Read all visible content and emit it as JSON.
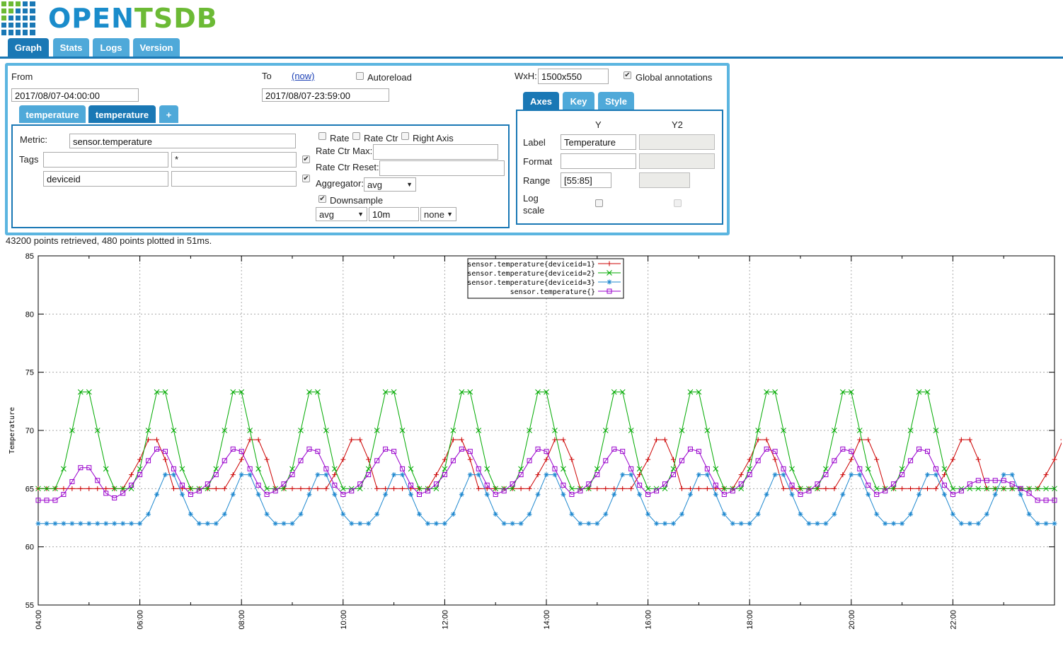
{
  "app": {
    "logo_open": "OPEN",
    "logo_tsdb": "TSDB"
  },
  "tabs": [
    {
      "label": "Graph",
      "active": true
    },
    {
      "label": "Stats"
    },
    {
      "label": "Logs"
    },
    {
      "label": "Version"
    }
  ],
  "query": {
    "from_label": "From",
    "from_value": "2017/08/07-04:00:00",
    "to_label": "To",
    "to_now_link": "(now)",
    "to_value": "2017/08/07-23:59:00",
    "autoreload_label": "Autoreload",
    "wxh_label": "WxH:",
    "wxh_value": "1500x550",
    "global_annotations_label": "Global annotations",
    "metric_tabs": [
      "temperature",
      "temperature",
      "+"
    ],
    "metric_label": "Metric:",
    "metric_value": "sensor.temperature",
    "tags_label": "Tags",
    "tags": [
      {
        "key": "",
        "value": "*"
      },
      {
        "key": "deviceid",
        "value": ""
      }
    ],
    "rate_label": "Rate",
    "rate_ctr_label": "Rate Ctr",
    "right_axis_label": "Right Axis",
    "rate_ctr_max_label": "Rate Ctr Max:",
    "rate_ctr_reset_label": "Rate Ctr Reset:",
    "aggregator_label": "Aggregator:",
    "aggregator_value": "avg",
    "downsample_label": "Downsample",
    "downsample_func": "avg",
    "downsample_interval": "10m",
    "downsample_fill": "none"
  },
  "axes": {
    "tabs": [
      "Axes",
      "Key",
      "Style"
    ],
    "col_y": "Y",
    "col_y2": "Y2",
    "label_label": "Label",
    "label_y": "Temperature",
    "format_label": "Format",
    "range_label": "Range",
    "range_y": "[55:85]",
    "log_label_1": "Log",
    "log_label_2": "scale"
  },
  "status": "43200 points retrieved, 480 points plotted in 51ms.",
  "colors": {
    "accent": "#1a78b5",
    "tab_light": "#4fa9d9",
    "panel_border": "#5bb5e0"
  },
  "chart_data": {
    "type": "line",
    "ylabel": "Temperature",
    "ylim": [
      55,
      85
    ],
    "yticks": [
      55,
      60,
      65,
      70,
      75,
      80,
      85
    ],
    "xlim": [
      "04:00",
      "24:00"
    ],
    "xticks": [
      "04:00",
      "06:00",
      "08:00",
      "10:00",
      "12:00",
      "14:00",
      "16:00",
      "18:00",
      "20:00",
      "22:00"
    ],
    "grid": true,
    "legend_position": "top-center",
    "series": [
      {
        "name": "sensor.temperature{deviceid=1}",
        "color": "#cc0000",
        "marker": "plus",
        "x_start_hours": 4.0,
        "x_step_minutes": 10,
        "values": [
          65,
          65,
          65,
          65,
          65,
          65,
          65,
          65,
          65,
          65,
          65,
          66.2,
          67.5,
          69.2,
          69.2,
          67.5,
          65,
          65,
          65,
          65,
          65,
          65,
          65,
          66.2,
          67.5,
          69.2,
          69.2,
          67.5,
          65,
          65,
          65,
          65,
          65,
          65,
          65,
          66.2,
          67.5,
          69.2,
          69.2,
          67.5,
          65,
          65,
          65,
          65,
          65,
          65,
          65,
          66.2,
          67.5,
          69.2,
          69.2,
          67.5,
          65,
          65,
          65,
          65,
          65,
          65,
          65,
          66.2,
          67.5,
          69.2,
          69.2,
          67.5,
          65,
          65,
          65,
          65,
          65,
          65,
          65,
          66.2,
          67.5,
          69.2,
          69.2,
          67.5,
          65,
          65,
          65,
          65,
          65,
          65,
          65,
          66.2,
          67.5,
          69.2,
          69.2,
          67.5,
          65,
          65,
          65,
          65,
          65,
          65,
          65,
          66.2,
          67.5,
          69.2,
          69.2,
          67.5,
          65,
          65,
          65,
          65,
          65,
          65,
          65,
          66.2,
          67.5,
          69.2,
          69.2,
          67.5,
          65,
          65,
          65,
          65,
          65,
          65,
          65,
          66.2,
          67.5,
          69.2,
          69.2,
          67.5,
          65,
          65
        ]
      },
      {
        "name": "sensor.temperature{deviceid=2}",
        "color": "#00aa00",
        "marker": "cross",
        "x_start_hours": 4.0,
        "x_step_minutes": 10,
        "values": [
          65,
          65,
          65,
          66.7,
          70,
          73.3,
          73.3,
          70,
          66.7,
          65,
          65,
          65,
          66.7,
          70,
          73.3,
          73.3,
          70,
          66.7,
          65,
          65,
          65,
          66.7,
          70,
          73.3,
          73.3,
          70,
          66.7,
          65,
          65,
          65,
          66.7,
          70,
          73.3,
          73.3,
          70,
          66.7,
          65,
          65,
          65,
          66.7,
          70,
          73.3,
          73.3,
          70,
          66.7,
          65,
          65,
          65,
          66.7,
          70,
          73.3,
          73.3,
          70,
          66.7,
          65,
          65,
          65,
          66.7,
          70,
          73.3,
          73.3,
          70,
          66.7,
          65,
          65,
          65,
          66.7,
          70,
          73.3,
          73.3,
          70,
          66.7,
          65,
          65,
          65,
          66.7,
          70,
          73.3,
          73.3,
          70,
          66.7,
          65,
          65,
          65,
          66.7,
          70,
          73.3,
          73.3,
          70,
          66.7,
          65,
          65,
          65,
          66.7,
          70,
          73.3,
          73.3,
          70,
          66.7,
          65,
          65,
          65,
          66.7,
          70,
          73.3,
          73.3,
          70,
          66.7,
          65,
          65,
          65,
          65,
          65,
          65,
          65,
          65,
          65,
          65,
          65,
          65,
          65
        ]
      },
      {
        "name": "sensor.temperature{deviceid=3}",
        "color": "#1e88cf",
        "marker": "star",
        "x_start_hours": 4.0,
        "x_step_minutes": 10,
        "values": [
          62,
          62,
          62,
          62,
          62,
          62,
          62,
          62,
          62,
          62,
          62,
          62,
          62,
          62.8,
          64.5,
          66.2,
          66.2,
          64.5,
          62.8,
          62,
          62,
          62,
          62.8,
          64.5,
          66.2,
          66.2,
          64.5,
          62.8,
          62,
          62,
          62,
          62.8,
          64.5,
          66.2,
          66.2,
          64.5,
          62.8,
          62,
          62,
          62,
          62.8,
          64.5,
          66.2,
          66.2,
          64.5,
          62.8,
          62,
          62,
          62,
          62.8,
          64.5,
          66.2,
          66.2,
          64.5,
          62.8,
          62,
          62,
          62,
          62.8,
          64.5,
          66.2,
          66.2,
          64.5,
          62.8,
          62,
          62,
          62,
          62.8,
          64.5,
          66.2,
          66.2,
          64.5,
          62.8,
          62,
          62,
          62,
          62.8,
          64.5,
          66.2,
          66.2,
          64.5,
          62.8,
          62,
          62,
          62,
          62.8,
          64.5,
          66.2,
          66.2,
          64.5,
          62.8,
          62,
          62,
          62,
          62.8,
          64.5,
          66.2,
          66.2,
          64.5,
          62.8,
          62,
          62,
          62,
          62.8,
          64.5,
          66.2,
          66.2,
          64.5,
          62.8,
          62,
          62,
          62,
          62.8,
          64.5,
          66.2,
          66.2,
          64.5,
          62.8,
          62,
          62,
          62
        ]
      },
      {
        "name": "sensor.temperature{}",
        "color": "#9900cc",
        "marker": "square",
        "x_start_hours": 4.0,
        "x_step_minutes": 10,
        "values": [
          64,
          64,
          64,
          64.5,
          65.6,
          66.8,
          66.8,
          65.7,
          64.6,
          64.2,
          64.6,
          65.3,
          66.2,
          67.4,
          68.4,
          68.2,
          66.7,
          65.3,
          64.5,
          64.8,
          65.4,
          66.2,
          67.4,
          68.4,
          68.2,
          66.7,
          65.3,
          64.5,
          64.8,
          65.4,
          66.2,
          67.4,
          68.4,
          68.2,
          66.7,
          65.3,
          64.5,
          64.8,
          65.4,
          66.2,
          67.4,
          68.4,
          68.2,
          66.7,
          65.3,
          64.5,
          64.8,
          65.4,
          66.2,
          67.4,
          68.4,
          68.2,
          66.7,
          65.3,
          64.5,
          64.8,
          65.4,
          66.2,
          67.4,
          68.4,
          68.2,
          66.7,
          65.3,
          64.5,
          64.8,
          65.4,
          66.2,
          67.4,
          68.4,
          68.2,
          66.7,
          65.3,
          64.5,
          64.8,
          65.4,
          66.2,
          67.4,
          68.4,
          68.2,
          66.7,
          65.3,
          64.5,
          64.8,
          65.4,
          66.2,
          67.4,
          68.4,
          68.2,
          66.7,
          65.3,
          64.5,
          64.8,
          65.4,
          66.2,
          67.4,
          68.4,
          68.2,
          66.7,
          65.3,
          64.5,
          64.8,
          65.4,
          66.2,
          67.4,
          68.4,
          68.2,
          66.7,
          65.3,
          64.5,
          64.8,
          65.4,
          65.7,
          65.7,
          65.7,
          65.7,
          65.4,
          65,
          64.6,
          64,
          64,
          64
        ]
      }
    ]
  }
}
